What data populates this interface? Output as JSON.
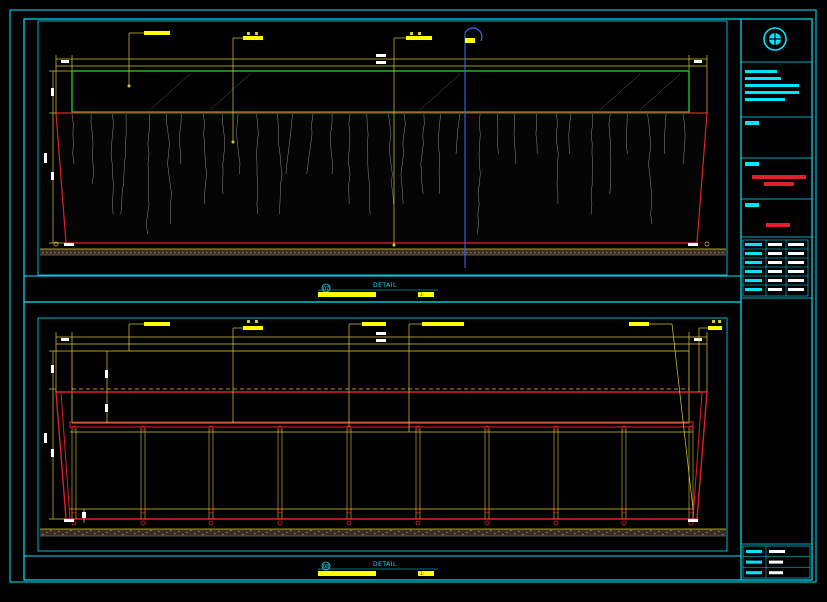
{
  "colors": {
    "background": "#000000",
    "frame": "#00e5ff",
    "red": "#e0202a",
    "green": "#22e022",
    "yellow": "#ffff00",
    "dim_line": "#d9c830",
    "gray": "#9aa0a6",
    "white": "#ffffff",
    "blue": "#3a6bff",
    "ground": "#7a6a5a"
  },
  "icons": {
    "logo": "circular-company-logo-icon",
    "north": "section-pointer-icon"
  },
  "views": [
    {
      "id": "07",
      "caption": "DETAIL",
      "title": "",
      "scale": "1:",
      "callouts": [
        "",
        "",
        "",
        ""
      ],
      "dimensions": {
        "overall_width": "",
        "end_left": "",
        "end_right": "",
        "height_total": "",
        "height_upper": "",
        "height_lower": ""
      }
    },
    {
      "id": "08",
      "caption": "DETAIL",
      "title": "",
      "scale": "1:",
      "callouts": [
        "",
        "",
        "",
        "",
        ""
      ],
      "dimensions": {
        "overall_width": "",
        "end_left": "",
        "end_right": "",
        "height_total": "",
        "height_upper": "",
        "height_lower": ""
      }
    }
  ],
  "title_block": {
    "company_notes": [
      "",
      "",
      "",
      "",
      ""
    ],
    "project_label": "",
    "project_name": [
      "",
      ""
    ],
    "drawing_label": "",
    "drawing_name": "",
    "sign_rows": [
      [
        "",
        "",
        ""
      ],
      [
        "",
        "",
        ""
      ],
      [
        "",
        "",
        ""
      ],
      [
        "",
        "",
        ""
      ],
      [
        "",
        "",
        ""
      ],
      [
        "",
        "",
        ""
      ]
    ],
    "footer_rows": [
      [
        "",
        ""
      ],
      [
        "",
        ""
      ],
      [
        "",
        ""
      ]
    ]
  }
}
